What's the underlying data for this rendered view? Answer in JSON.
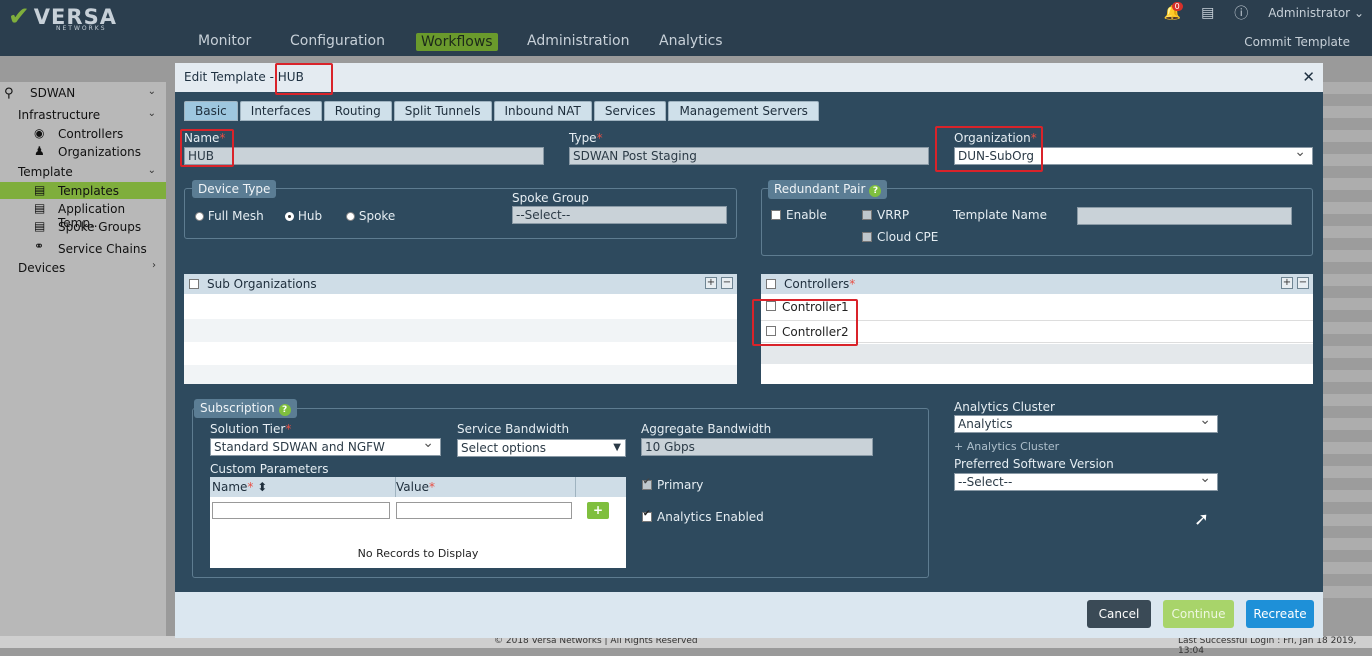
{
  "app": {
    "logo": "VERSA",
    "logo_sub": "NETWORKS",
    "nav": [
      "Monitor",
      "Configuration",
      "Workflows",
      "Administration",
      "Analytics"
    ],
    "active_nav": "Workflows",
    "notifications": "0",
    "user": "Administrator",
    "commit": "Commit Template"
  },
  "sidebar": {
    "sdwan": "SDWAN",
    "infrastructure": "Infrastructure",
    "controllers": "Controllers",
    "organizations": "Organizations",
    "template": "Template",
    "templates": "Templates",
    "application_templates": "Application Temp...",
    "spoke_groups": "Spoke Groups",
    "service_chains": "Service Chains",
    "devices": "Devices"
  },
  "footer": {
    "copyright": "© 2018 Versa Networks | All Rights Reserved",
    "last_login": "Last Successful Login : Fri, Jan 18 2019, 13:04"
  },
  "modal": {
    "title": "Edit Template - HUB",
    "tabs": [
      "Basic",
      "Interfaces",
      "Routing",
      "Split Tunnels",
      "Inbound NAT",
      "Services",
      "Management Servers"
    ],
    "name_label": "Name",
    "name_value": "HUB",
    "type_label": "Type",
    "type_value": "SDWAN Post Staging",
    "org_label": "Organization",
    "org_value": "DUN-SubOrg",
    "device_type": {
      "legend": "Device Type",
      "options": [
        "Full Mesh",
        "Hub",
        "Spoke"
      ],
      "selected": "Hub"
    },
    "spoke_group": {
      "label": "Spoke Group",
      "value": "--Select--"
    },
    "redundant_pair": {
      "legend": "Redundant Pair",
      "enable": "Enable",
      "vrrp": "VRRP",
      "cloud_cpe": "Cloud CPE",
      "template_name": "Template Name"
    },
    "sub_orgs": {
      "header": "Sub Organizations"
    },
    "controllers": {
      "header": "Controllers",
      "rows": [
        "Controller1",
        "Controller2"
      ]
    },
    "subscription": {
      "legend": "Subscription",
      "solution_tier_label": "Solution Tier",
      "solution_tier_value": "Standard SDWAN and NGFW",
      "service_bw_label": "Service Bandwidth",
      "service_bw_value": "Select options",
      "aggregate_bw_label": "Aggregate Bandwidth",
      "aggregate_bw_value": "10 Gbps",
      "custom_params": "Custom Parameters",
      "col_name": "Name",
      "col_value": "Value",
      "no_records": "No Records to Display",
      "primary": "Primary",
      "analytics_enabled": "Analytics Enabled"
    },
    "analytics": {
      "cluster_label": "Analytics Cluster",
      "cluster_value": "Analytics",
      "add_cluster": "+ Analytics Cluster",
      "pref_sw_label": "Preferred Software Version",
      "pref_sw_value": "--Select--"
    },
    "buttons": {
      "cancel": "Cancel",
      "continue": "Continue",
      "recreate": "Recreate"
    }
  }
}
